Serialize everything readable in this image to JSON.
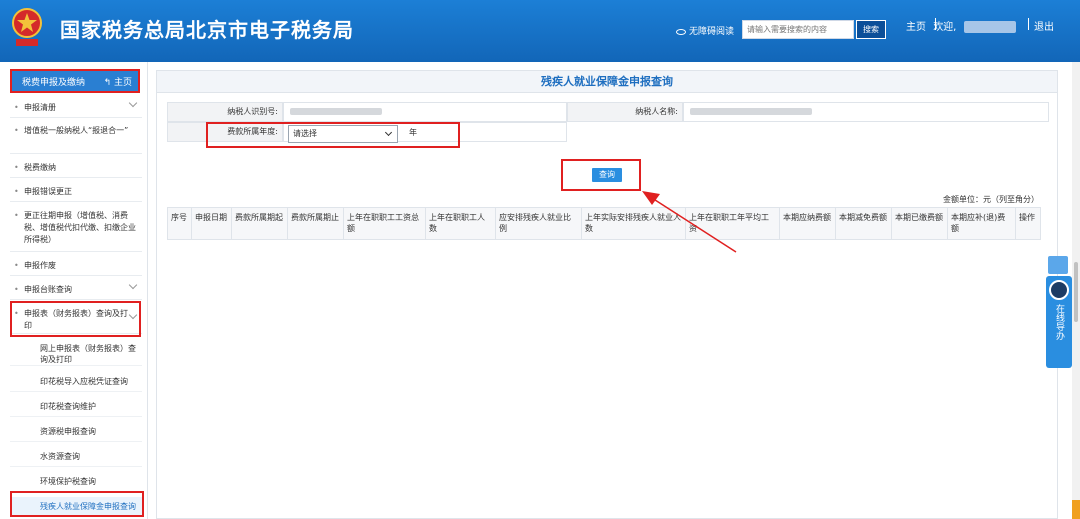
{
  "header": {
    "title": "国家税务总局北京市电子税务局",
    "emblem_text": "中国税务",
    "accessibility": "无障碍阅读",
    "search_placeholder": "请输入需要搜索的内容",
    "search_button": "搜索",
    "nav_home": "主页",
    "welcome": "欢迎,",
    "logout": "退出"
  },
  "sidebar": {
    "head": "税费申报及缴纳",
    "home": "主页",
    "items": [
      "申报清册",
      "增值税一般纳税人“报退合一”",
      "税费缴纳",
      "申报错误更正",
      "更正往期申报（增值税、消费税、增值税代扣代缴、扣缴企业所得税）",
      "申报作废",
      "申报台账查询",
      "申报表（财务报表）查询及打印"
    ],
    "sub_items": [
      "网上申报表（财务报表）查询及打印",
      "印花税导入应税凭证查询",
      "印花税查询维护",
      "资源税申报查询",
      "水资源查询",
      "环境保护税查询",
      "残疾人就业保障金申报查询"
    ]
  },
  "main": {
    "title": "残疾人就业保障金申报查询",
    "taxpayer_id_label": "纳税人识别号:",
    "taxpayer_name_label": "纳税人名称:",
    "period_label": "费款所属年度:",
    "period_select": "请选择",
    "year_suffix": "年",
    "query_button": "查询",
    "unit_note": "金额单位：元（列至角分）",
    "columns": [
      "序号",
      "申报日期",
      "费款所属期起",
      "费款所属期止",
      "上年在职职工工资总额",
      "上年在职职工人数",
      "应安排残疾人就业比例",
      "上年实际安排残疾人就业人数",
      "上年在职职工年平均工资",
      "本期应纳费额",
      "本期减免费额",
      "本期已缴费额",
      "本期应补(退)费额",
      "操作"
    ]
  },
  "float": {
    "guide": "在线导办"
  },
  "colors": {
    "header_blue": "#1266b8",
    "accent_blue": "#2a8ee0",
    "highlight_red": "#e02020"
  }
}
